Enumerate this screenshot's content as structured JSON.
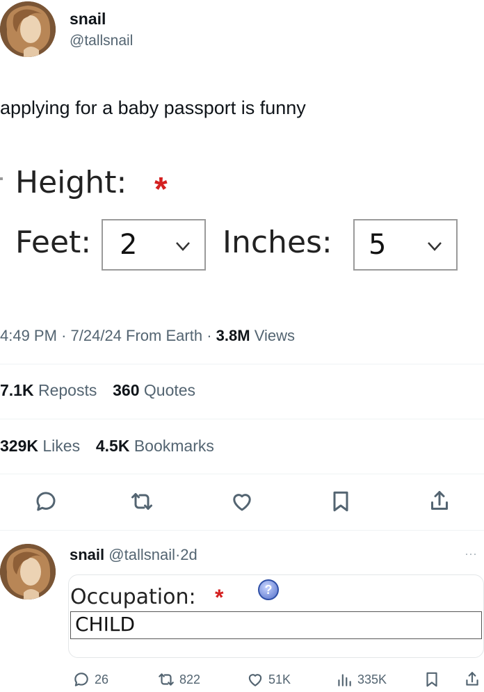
{
  "tweet": {
    "display_name": "snail",
    "handle": "@tallsnail",
    "text": "applying for a baby passport is funny",
    "meta": {
      "time": "4:49 PM",
      "date": "7/24/24",
      "source": "From Earth",
      "views_count": "3.8M",
      "views_label": "Views"
    },
    "stats": {
      "reposts_count": "7.1K",
      "reposts_label": "Reposts",
      "quotes_count": "360",
      "quotes_label": "Quotes",
      "likes_count": "329K",
      "likes_label": "Likes",
      "bookmarks_count": "4.5K",
      "bookmarks_label": "Bookmarks"
    },
    "actions": [
      "reply-icon",
      "repost-icon",
      "like-icon",
      "bookmark-icon",
      "share-icon"
    ]
  },
  "form_image": {
    "height_label": "Height:",
    "required_mark": "*",
    "feet_label": "Feet:",
    "feet_value": "2",
    "inches_label": "Inches:",
    "inches_value": "5"
  },
  "reply": {
    "display_name": "snail",
    "handle": "@tallsnail",
    "age": "2d",
    "more_label": "···",
    "form": {
      "occupation_label": "Occupation:",
      "required_mark": "*",
      "help_glyph": "?",
      "occupation_value": "CHILD"
    },
    "stats": {
      "replies": "26",
      "reposts": "822",
      "likes": "51K",
      "views": "335K"
    }
  },
  "colors": {
    "text": "#0f1419",
    "muted": "#536471",
    "required": "#d42020"
  }
}
